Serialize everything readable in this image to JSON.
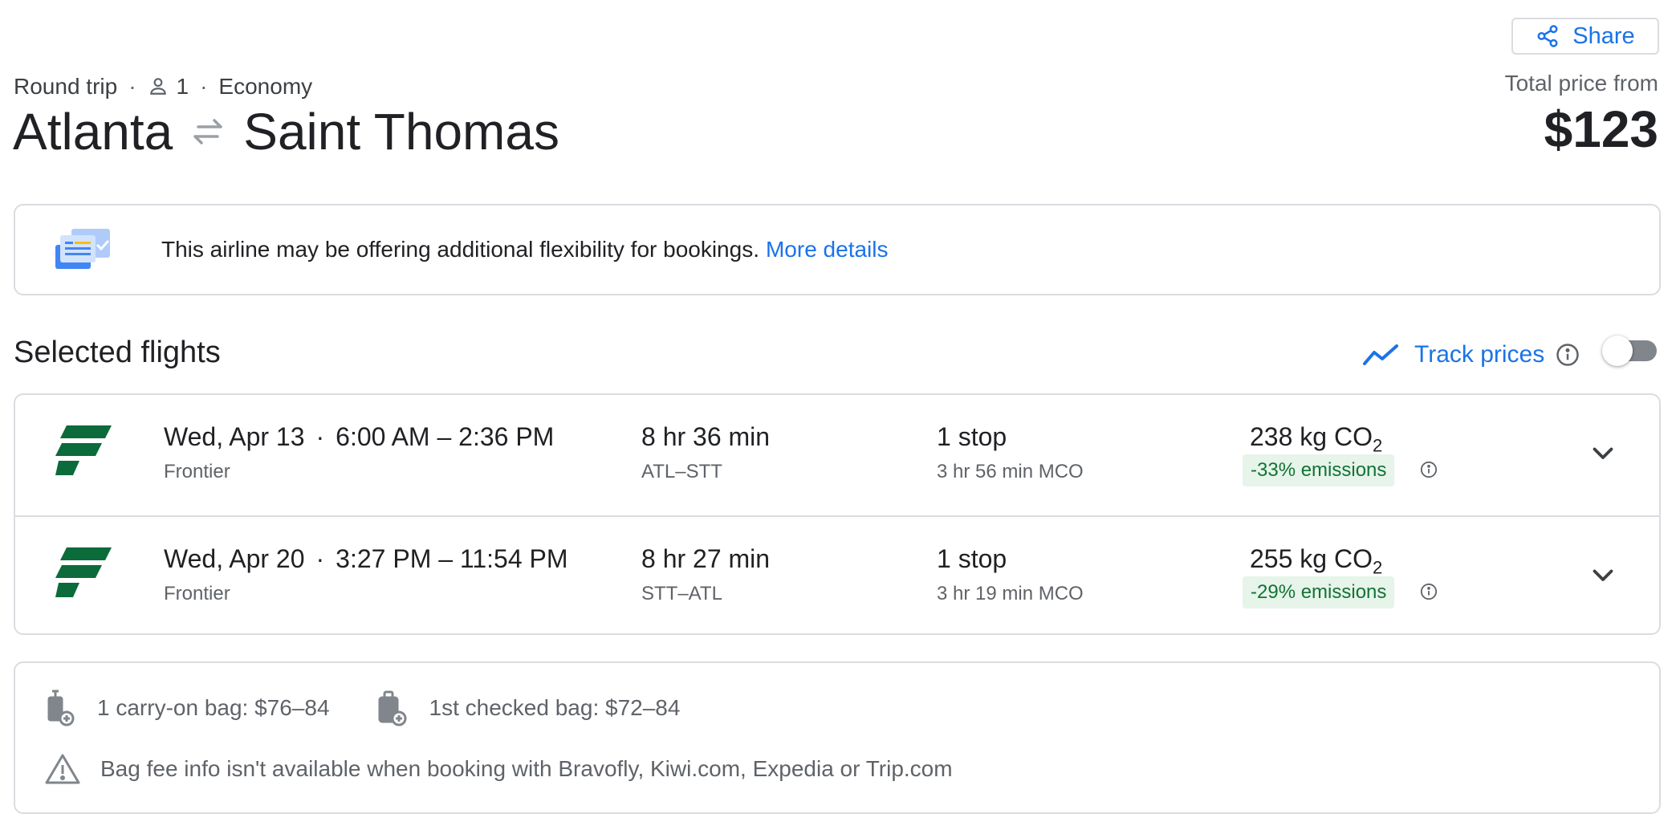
{
  "header": {
    "share_label": "Share",
    "trip_type": "Round trip",
    "passengers": "1",
    "cabin": "Economy",
    "origin": "Atlanta",
    "destination": "Saint Thomas",
    "total_label": "Total price from",
    "total_price": "$123"
  },
  "flex_notice": {
    "message": "This airline may be offering additional flexibility for bookings.",
    "link": "More details"
  },
  "selected": {
    "title": "Selected flights",
    "track_label": "Track prices",
    "track_enabled": false
  },
  "flights": [
    {
      "date": "Wed, Apr 13",
      "time_range": "6:00 AM – 2:36 PM",
      "airline": "Frontier",
      "duration": "8 hr 36 min",
      "route": "ATL–STT",
      "stops": "1 stop",
      "layover": "3 hr 56 min MCO",
      "co2_value": "238 kg CO",
      "co2_sub": "2",
      "emissions": "-33% emissions"
    },
    {
      "date": "Wed, Apr 20",
      "time_range": "3:27 PM – 11:54 PM",
      "airline": "Frontier",
      "duration": "8 hr 27 min",
      "route": "STT–ATL",
      "stops": "1 stop",
      "layover": "3 hr 19 min MCO",
      "co2_value": "255 kg CO",
      "co2_sub": "2",
      "emissions": "-29% emissions"
    }
  ],
  "bags": {
    "carry_on": "1 carry-on bag: $76–84",
    "checked": "1st checked bag: $72–84",
    "warning": "Bag fee info isn't available when booking with Bravofly, Kiwi.com, Expedia or Trip.com"
  },
  "colors": {
    "accent": "#1a73e8",
    "frontier_green": "#0b6b3a",
    "emissions_bg": "#e6f4ea",
    "emissions_text": "#137333"
  }
}
